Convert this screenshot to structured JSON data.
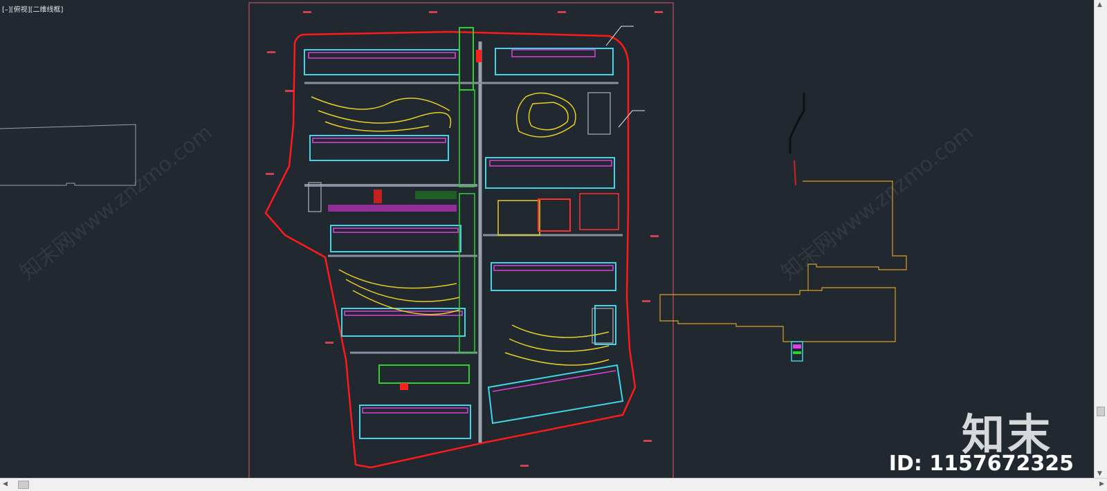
{
  "viewport": {
    "label": "[–][俯视][二维线框]"
  },
  "watermarks": {
    "left": "知末网www.znzmo.com",
    "right": "知末网www.znzmo.com"
  },
  "brand": {
    "logo_text": "知末",
    "id_label": "ID: 1157672325"
  },
  "scrollbars": {
    "up_arrow": "▲",
    "down_arrow": "▼",
    "left_arrow": "◀",
    "right_arrow": "▶"
  },
  "colors": {
    "background": "#212830",
    "sheet_border": "#e05a6a",
    "site_boundary": "#ff1a1a",
    "building_cyan": "#3fd6e8",
    "building_magenta": "#e040e0",
    "road_yellow": "#e8d020",
    "green": "#30d030",
    "outline_gray": "#9aa0a8",
    "outline_orange": "#d8a020"
  }
}
